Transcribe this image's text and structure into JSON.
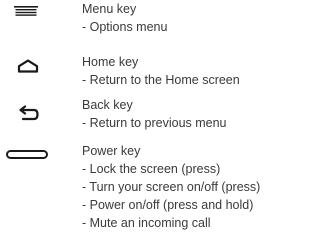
{
  "keys": [
    {
      "icon": "menu-icon",
      "name": "Menu key",
      "functions": [
        "- Options menu"
      ]
    },
    {
      "icon": "home-icon",
      "name": "Home key",
      "functions": [
        "- Return to the Home screen"
      ]
    },
    {
      "icon": "back-arrow-icon",
      "name": "Back key",
      "functions": [
        "- Return to previous menu"
      ]
    },
    {
      "icon": "power-key-icon",
      "name": "Power key",
      "functions": [
        "- Lock the screen (press)",
        "- Turn your screen on/off (press)",
        "- Power on/off (press and hold)",
        "- Mute an incoming call"
      ]
    }
  ],
  "colors": {
    "text": "#3a3a3a",
    "icon": "#1a1a1a"
  }
}
